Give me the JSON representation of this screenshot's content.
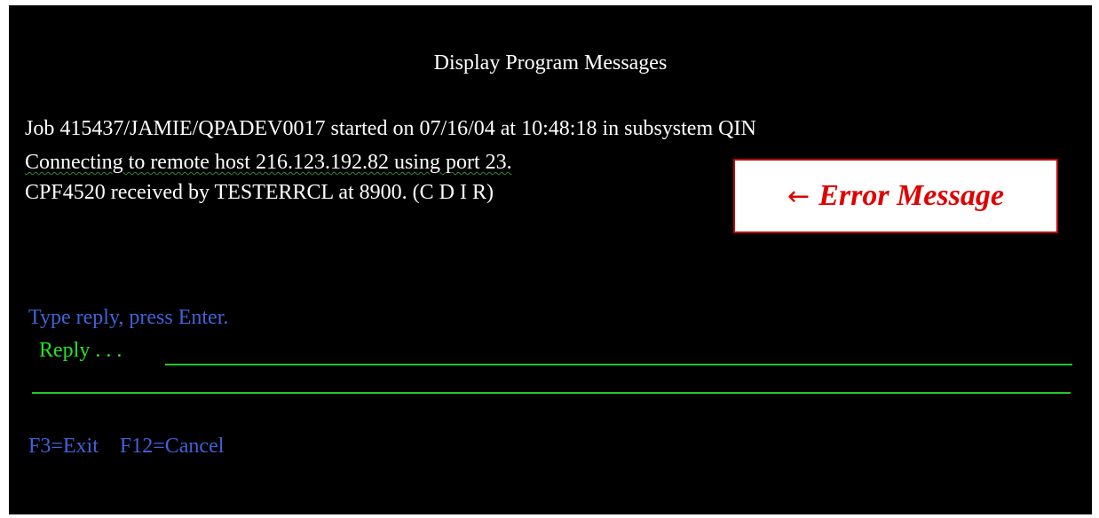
{
  "screen": {
    "title": "Display Program Messages"
  },
  "messages": [
    "Job 415437/JAMIE/QPADEV0017 started on 07/16/04 at 10:48:18 in subsystem QIN",
    "Connecting to remote host 216.123.192.82 using port 23.",
    "CPF4520 received by TESTERRCL at 8900. (C D I R)"
  ],
  "callout": {
    "arrow": "←",
    "label": "Error Message"
  },
  "reply": {
    "prompt": "Type reply, press Enter.",
    "label": "Reply . . .",
    "value": ""
  },
  "function_keys": [
    "F3=Exit",
    "F12=Cancel"
  ],
  "colors": {
    "background": "#000000",
    "text": "#ffffff",
    "prompt": "#3f63d8",
    "reply": "#27e227",
    "callout": "#e00000"
  }
}
